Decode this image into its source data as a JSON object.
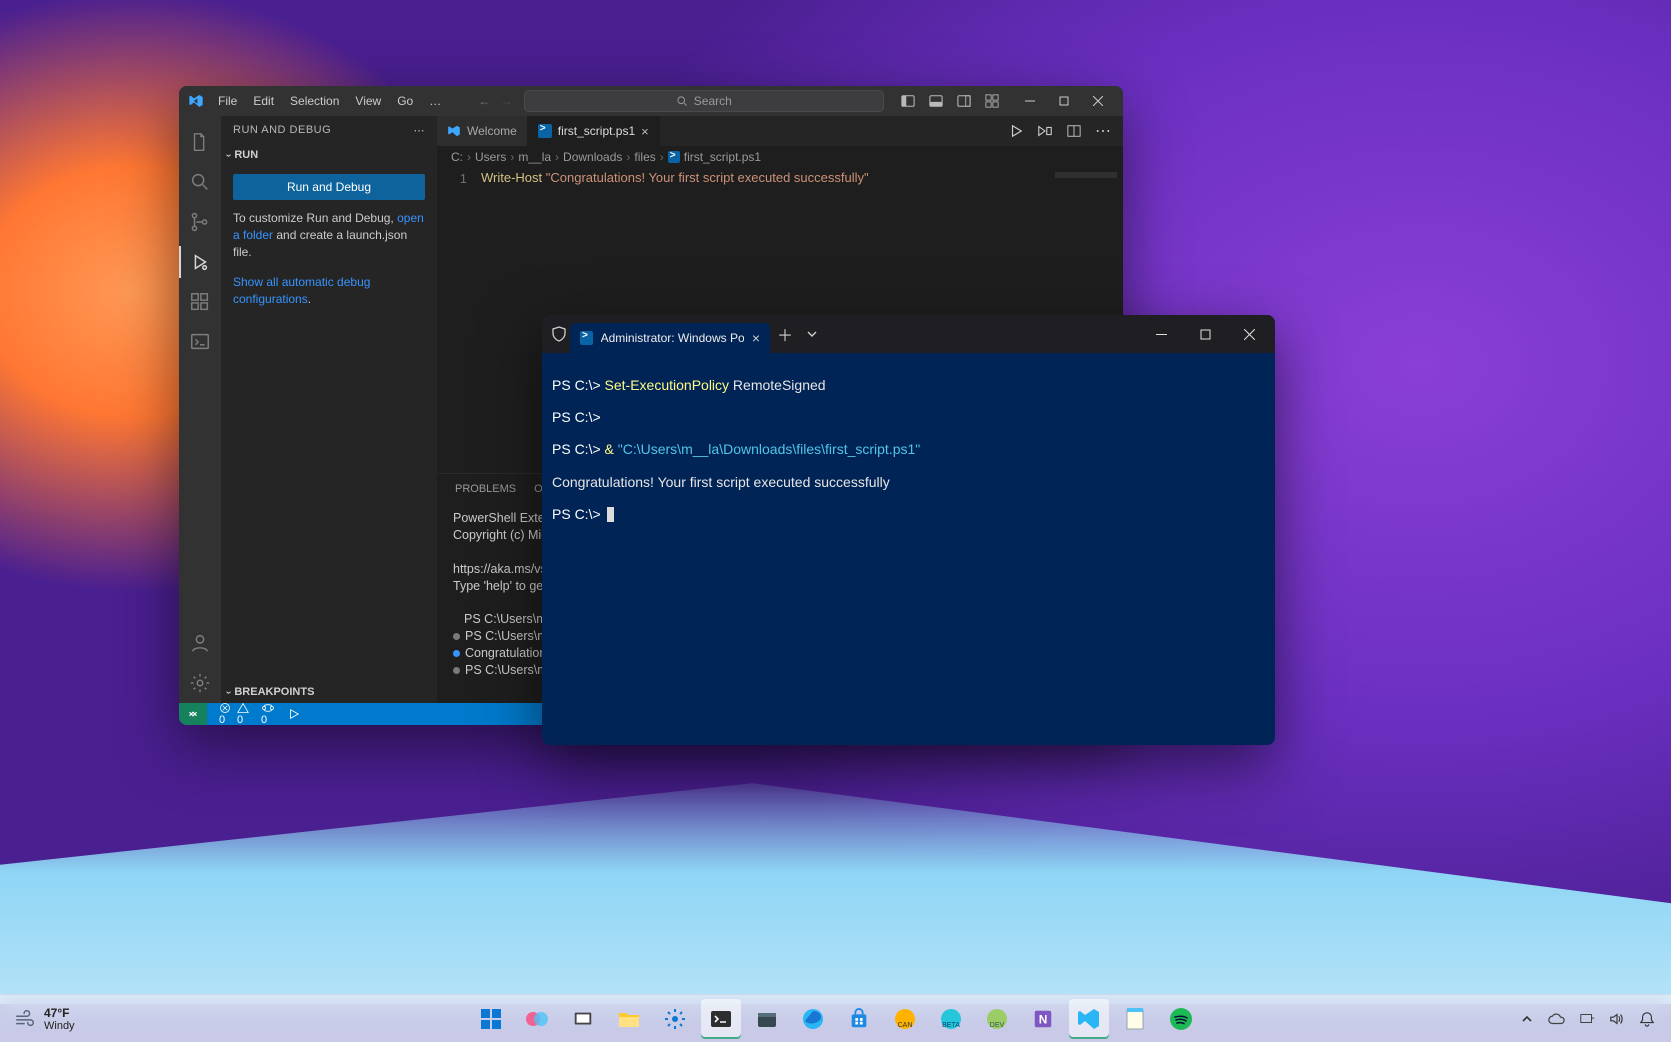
{
  "vscode": {
    "menu": [
      "File",
      "Edit",
      "Selection",
      "View",
      "Go",
      "…"
    ],
    "search_placeholder": "Search",
    "sidebar": {
      "title": "RUN AND DEBUG",
      "run_section": "RUN",
      "run_button": "Run and Debug",
      "hint_pre": "To customize Run and Debug, ",
      "hint_link": "open a folder",
      "hint_post": " and create a launch.json file.",
      "show_all_link": "Show all automatic debug configurations",
      "breakpoints": "BREAKPOINTS"
    },
    "tabs": {
      "welcome": "Welcome",
      "file": "first_script.ps1"
    },
    "breadcrumbs": [
      "C:",
      "Users",
      "m__la",
      "Downloads",
      "files",
      "first_script.ps1"
    ],
    "code": {
      "line_no": "1",
      "cmd": "Write-Host",
      "str": "\"Congratulations! Your first script executed successfully\""
    },
    "panel": {
      "tabs": [
        "PROBLEMS",
        "OUTPUT"
      ],
      "lines": [
        "PowerShell Extens",
        "Copyright (c) Mic",
        "",
        "https://aka.ms/vs",
        "Type 'help' to ge",
        "",
        "PS C:\\Users\\m__la",
        "PS C:\\Users\\m__la",
        "Congratulations!",
        "PS C:\\Users\\m__la"
      ]
    },
    "status": {
      "errors": "0",
      "warnings": "0",
      "ports": "0"
    }
  },
  "terminal": {
    "tab_title": "Administrator: Windows Powe",
    "lines": [
      {
        "prompt": "PS C:\\> ",
        "cmd": "Set-ExecutionPolicy",
        "arg": " RemoteSigned"
      },
      {
        "prompt": "PS C:\\> "
      },
      {
        "prompt": "PS C:\\> ",
        "amp": "& ",
        "path": "\"C:\\Users\\m__la\\Downloads\\files\\first_script.ps1\""
      },
      {
        "out": "Congratulations! Your first script executed successfully"
      },
      {
        "prompt": "PS C:\\> ",
        "cursor": true
      }
    ]
  },
  "taskbar": {
    "temp": "47°F",
    "cond": "Windy"
  }
}
